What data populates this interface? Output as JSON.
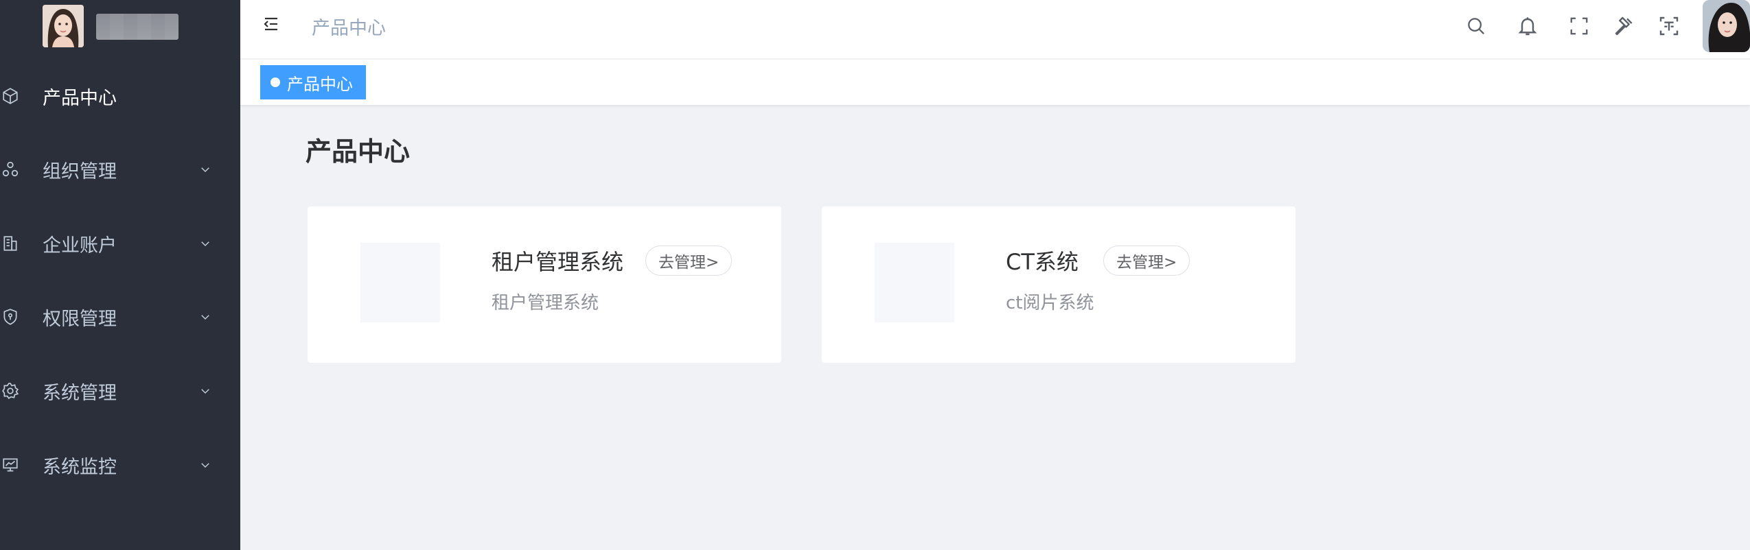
{
  "sidebar": {
    "items": [
      {
        "label": "产品中心",
        "icon": "cube-icon",
        "has_children": false,
        "active": true
      },
      {
        "label": "组织管理",
        "icon": "organization-icon",
        "has_children": true,
        "active": false
      },
      {
        "label": "企业账户",
        "icon": "building-icon",
        "has_children": true,
        "active": false
      },
      {
        "label": "权限管理",
        "icon": "shield-icon",
        "has_children": true,
        "active": false
      },
      {
        "label": "系统管理",
        "icon": "gear-icon",
        "has_children": true,
        "active": false
      },
      {
        "label": "系统监控",
        "icon": "monitor-icon",
        "has_children": true,
        "active": false
      }
    ]
  },
  "navbar": {
    "breadcrumb": "产品中心",
    "icons": [
      "search-icon",
      "bell-icon",
      "fullscreen-icon",
      "hammer-icon",
      "text-scan-icon"
    ]
  },
  "tags": [
    {
      "label": "产品中心",
      "active": true
    }
  ],
  "main": {
    "title": "产品中心",
    "cards": [
      {
        "name": "租户管理系统",
        "button": "去管理>",
        "description": "租户管理系统"
      },
      {
        "name": "CT系统",
        "button": "去管理>",
        "description": "ct阅片系统"
      }
    ]
  },
  "colors": {
    "sidebar_bg": "#2b2f3a",
    "accent": "#409eff",
    "content_bg": "#f0f2f5"
  }
}
